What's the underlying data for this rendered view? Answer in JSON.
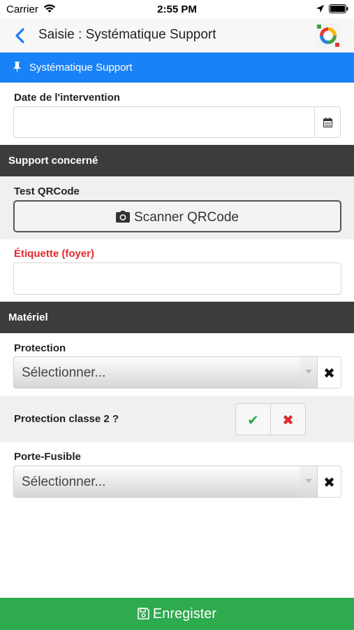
{
  "status_bar": {
    "carrier": "Carrier",
    "time": "2:55 PM"
  },
  "header": {
    "title": "Saisie : Systématique Support"
  },
  "banner": {
    "text": "Systématique Support"
  },
  "form": {
    "date_label": "Date de l'intervention",
    "date_value": "",
    "section_support": "Support concerné",
    "qrcode_label": "Test QRCode",
    "qrcode_button": "Scanner QRCode",
    "etiquette_label": "Étiquette (foyer)",
    "etiquette_value": "",
    "section_materiel": "Matériel",
    "protection_label": "Protection",
    "protection_value": "Sélectionner...",
    "protection_classe2_label": "Protection classe 2 ?",
    "yes_symbol": "✔",
    "no_symbol": "✖",
    "clear_symbol": "✖",
    "porte_fusible_label": "Porte-Fusible",
    "porte_fusible_value": "Sélectionner..."
  },
  "footer": {
    "save_label": "Enregister"
  },
  "colors": {
    "banner": "#1a82f7",
    "save": "#2eaa4f",
    "section": "#3a3c3e",
    "required": "#e2292e",
    "yes": "#2eaa4f",
    "no": "#e2292e"
  }
}
